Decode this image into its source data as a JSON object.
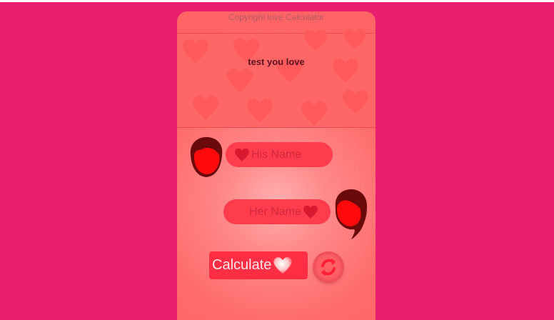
{
  "app": {
    "copyright": "Copyright love Calculator",
    "tagline": "test you love"
  },
  "form": {
    "his_placeholder": "His Name",
    "her_placeholder": "Her Name",
    "calculate_label": "Calculate"
  },
  "icons": {
    "heart": "heart-icon",
    "male_face": "male-avatar-icon",
    "female_face": "female-avatar-icon",
    "refresh": "refresh-icon"
  },
  "colors": {
    "page_background": "#ea1e6e",
    "card_background": "#ff6b6b",
    "input_background": "#ff3c4c",
    "calculate_button": "#ff2e44",
    "heart_decor": "#ff5a5a"
  }
}
